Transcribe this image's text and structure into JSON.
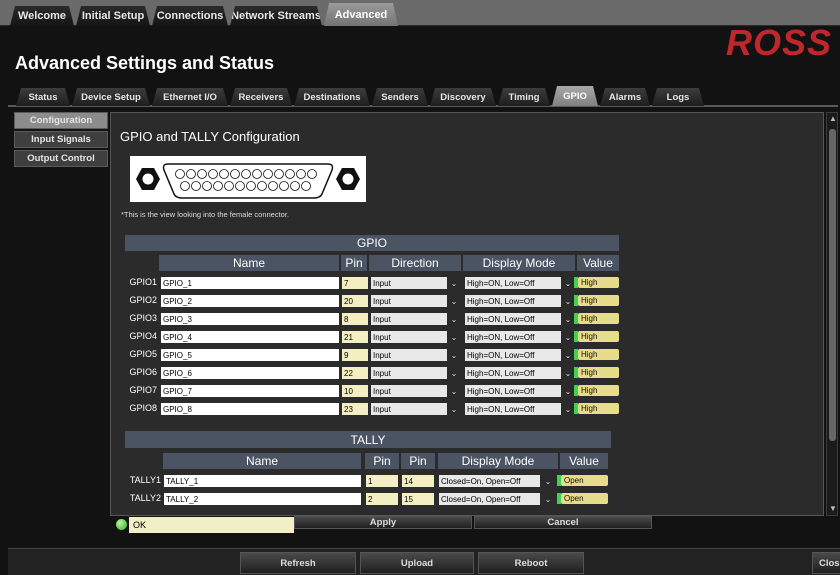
{
  "top_tabs": [
    "Welcome",
    "Initial Setup",
    "Connections",
    "Network Streams",
    "Advanced"
  ],
  "page_title": "Advanced Settings and Status",
  "logo": "ROSS",
  "sub_tabs": [
    "Status",
    "Device Setup",
    "Ethernet I/O",
    "Receivers",
    "Destinations",
    "Senders",
    "Discovery",
    "Timing",
    "GPIO",
    "Alarms",
    "Logs"
  ],
  "side_items": [
    "Configuration",
    "Input Signals",
    "Output Control"
  ],
  "section_title": "GPIO and TALLY Configuration",
  "view_note": "*This is the view looking into the female connector.",
  "gpio": {
    "title": "GPIO",
    "headers": [
      "Name",
      "Pin",
      "Direction",
      "Display Mode",
      "Value"
    ],
    "rows": [
      {
        "label": "GPIO1",
        "name": "GPIO_1",
        "pin": "7",
        "direction": "Input",
        "mode": "High=ON,  Low=Off",
        "value": "High"
      },
      {
        "label": "GPIO2",
        "name": "GPIO_2",
        "pin": "20",
        "direction": "Input",
        "mode": "High=ON,  Low=Off",
        "value": "High"
      },
      {
        "label": "GPIO3",
        "name": "GPIO_3",
        "pin": "8",
        "direction": "Input",
        "mode": "High=ON,  Low=Off",
        "value": "High"
      },
      {
        "label": "GPIO4",
        "name": "GPIO_4",
        "pin": "21",
        "direction": "Input",
        "mode": "High=ON,  Low=Off",
        "value": "High"
      },
      {
        "label": "GPIO5",
        "name": "GPIO_5",
        "pin": "9",
        "direction": "Input",
        "mode": "High=ON,  Low=Off",
        "value": "High"
      },
      {
        "label": "GPIO6",
        "name": "GPIO_6",
        "pin": "22",
        "direction": "Input",
        "mode": "High=ON,  Low=Off",
        "value": "High"
      },
      {
        "label": "GPIO7",
        "name": "GPIO_7",
        "pin": "10",
        "direction": "Input",
        "mode": "High=ON,  Low=Off",
        "value": "High"
      },
      {
        "label": "GPIO8",
        "name": "GPIO_8",
        "pin": "23",
        "direction": "Input",
        "mode": "High=ON,  Low=Off",
        "value": "High"
      }
    ]
  },
  "tally": {
    "title": "TALLY",
    "headers": [
      "Name",
      "Pin",
      "Pin",
      "Display Mode",
      "Value"
    ],
    "rows": [
      {
        "label": "TALLY1",
        "name": "TALLY_1",
        "pin1": "1",
        "pin2": "14",
        "mode": "Closed=On,  Open=Off",
        "value": "Open"
      },
      {
        "label": "TALLY2",
        "name": "TALLY_2",
        "pin1": "2",
        "pin2": "15",
        "mode": "Closed=On,  Open=Off",
        "value": "Open"
      }
    ]
  },
  "status": {
    "text": "OK",
    "apply": "Apply",
    "cancel": "Cancel"
  },
  "footer": {
    "refresh": "Refresh",
    "upload": "Upload",
    "reboot": "Reboot",
    "close": "Close"
  },
  "colors": {
    "header_bar": "#4a5463",
    "value_fill": "#e6dc8a",
    "logo": "#c0272d",
    "led": "#32a828"
  }
}
